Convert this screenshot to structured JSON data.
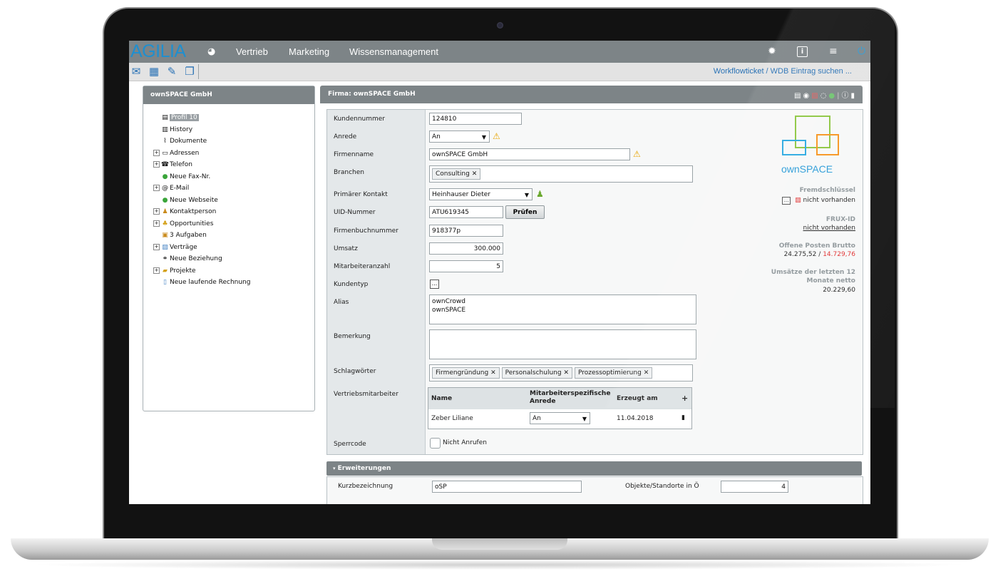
{
  "app": {
    "logo": "AGILIA"
  },
  "nav": {
    "items": [
      "Vertrieb",
      "Marketing",
      "Wissensmanagement"
    ]
  },
  "toolbar": {
    "search_link": "Workflowticket / WDB Eintrag suchen ..."
  },
  "left_panel": {
    "title": "ownSPACE GmbH",
    "tree": [
      {
        "label": "Profil 10",
        "icon": "profile-icon"
      },
      {
        "label": "History",
        "icon": "history-icon"
      },
      {
        "label": "Dokumente",
        "icon": "paperclip-icon"
      },
      {
        "label": "Adressen",
        "icon": "address-icon"
      },
      {
        "label": "Telefon",
        "icon": "phone-icon"
      },
      {
        "label": "Neue Fax-Nr.",
        "icon": "add-icon"
      },
      {
        "label": "E-Mail",
        "icon": "email-icon"
      },
      {
        "label": "Neue Webseite",
        "icon": "add-icon"
      },
      {
        "label": "Kontaktperson",
        "icon": "person-icon"
      },
      {
        "label": "Opportunities",
        "icon": "opportunity-icon"
      },
      {
        "label": "3 Aufgaben",
        "icon": "tasks-icon"
      },
      {
        "label": "Verträge",
        "icon": "contract-icon"
      },
      {
        "label": "Neue Beziehung",
        "icon": "relation-icon"
      },
      {
        "label": "Projekte",
        "icon": "folder-icon"
      },
      {
        "label": "Neue laufende Rechnung",
        "icon": "invoice-icon"
      }
    ]
  },
  "right_panel": {
    "title": "Firma: ownSPACE GmbH",
    "labels": {
      "kundennummer": "Kundennummer",
      "anrede": "Anrede",
      "firmenname": "Firmenname",
      "branchen": "Branchen",
      "primaerer_kontakt": "Primärer Kontakt",
      "uid": "UID-Nummer",
      "firmenbuch": "Firmenbuchnummer",
      "umsatz": "Umsatz",
      "mitarbeiter": "Mitarbeiteranzahl",
      "kundentyp": "Kundentyp",
      "alias": "Alias",
      "bemerkung": "Bemerkung",
      "schlagwoerter": "Schlagwörter",
      "vertriebsmitarbeiter": "Vertriebsmitarbeiter",
      "sperrcode": "Sperrcode"
    },
    "values": {
      "kundennummer": "124810",
      "anrede": "An",
      "firmenname": "ownSPACE GmbH",
      "branchen": [
        "Consulting"
      ],
      "primaerer_kontakt": "Heinhauser Dieter",
      "uid": "ATU619345",
      "firmenbuch": "918377p",
      "umsatz": "300.000",
      "mitarbeiter": "5",
      "kundentyp": "...",
      "alias_line1": "ownCrowd",
      "alias_line2": "ownSPACE",
      "schlagwoerter": [
        "Firmengründung",
        "Personalschulung",
        "Prozessoptimierung"
      ],
      "sperrcode": "Nicht Anrufen"
    },
    "pruefen_button": "Prüfen",
    "table": {
      "headers": [
        "Name",
        "Mitarbeiterspezifische Anrede",
        "Erzeugt am",
        "+"
      ],
      "row": {
        "name": "Zeber Liliane",
        "anrede": "An",
        "date": "11.04.2018"
      }
    },
    "info": {
      "brand": "ownSPACE",
      "fremdschluessel_label": "Fremdschlüssel",
      "fremdschluessel_value": "nicht vorhanden",
      "frux_label": "FRUX-ID",
      "frux_value": "nicht vorhanden",
      "posten_label": "Offene Posten Brutto",
      "posten_value1": "24.275,52",
      "posten_sep": "/",
      "posten_value2": "14.729,76",
      "umsaetze_label1": "Umsätze der letzten 12",
      "umsaetze_label2": "Monate netto",
      "umsaetze_value": "20.229,60"
    },
    "extensions": {
      "title": "Erweiterungen",
      "kurz_label": "Kurzbezeichnung",
      "kurz_value": "oSP",
      "objekte_label": "Objekte/Standorte in Ö",
      "objekte_value": "4"
    }
  },
  "colors": {
    "accent": "#1e8fd0",
    "header": "#7d8487",
    "warning": "#e8a400",
    "negative": "#e03030"
  }
}
